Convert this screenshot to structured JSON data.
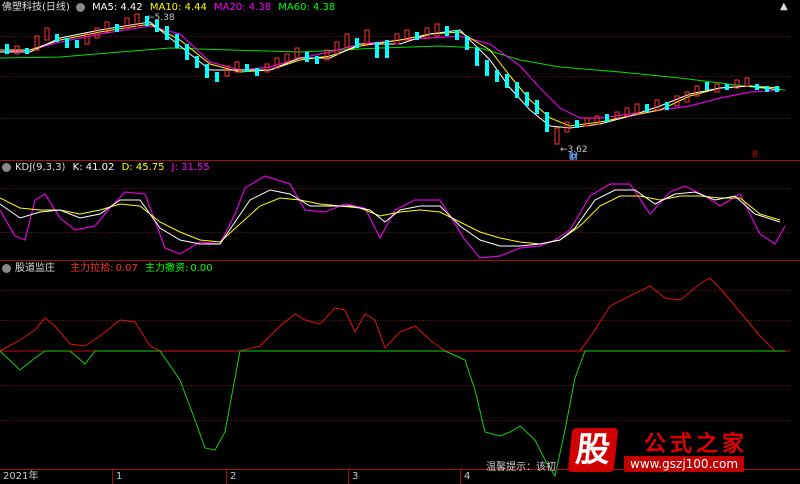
{
  "main": {
    "title": "佛塑科技(日线)",
    "ma": [
      {
        "label": "MA5: 4.42",
        "color": "#ffffff"
      },
      {
        "label": "MA10: 4.44",
        "color": "#ffff00"
      },
      {
        "label": "MA20: 4.38",
        "color": "#ff00ff"
      },
      {
        "label": "MA60: 4.38",
        "color": "#00ff00"
      }
    ],
    "high_label": "5.38",
    "low_label": "3.62",
    "low_marker": "财",
    "right_marker": "8"
  },
  "kdj": {
    "title": "KDJ(9,3,3)",
    "k": "K: 41.02",
    "d": "D: 45.75",
    "j": "J: 31.55",
    "k_color": "#ffffff",
    "d_color": "#ffff00",
    "j_color": "#ff00ff"
  },
  "ind": {
    "title": "股道监庄",
    "pull_label": "主力拉拾:",
    "pull_value": "0.07",
    "dump_label": "主力撒资:",
    "dump_value": "0.00",
    "pull_color": "#ff3030",
    "dump_color": "#00ff00"
  },
  "axis": {
    "labels": [
      "2021年",
      "1",
      "2",
      "3",
      "4"
    ]
  },
  "tip": "温馨提示：该初",
  "logo": {
    "char": "股",
    "name": "公式之家",
    "url": "www.gszj100.com"
  },
  "corner": "▲"
}
